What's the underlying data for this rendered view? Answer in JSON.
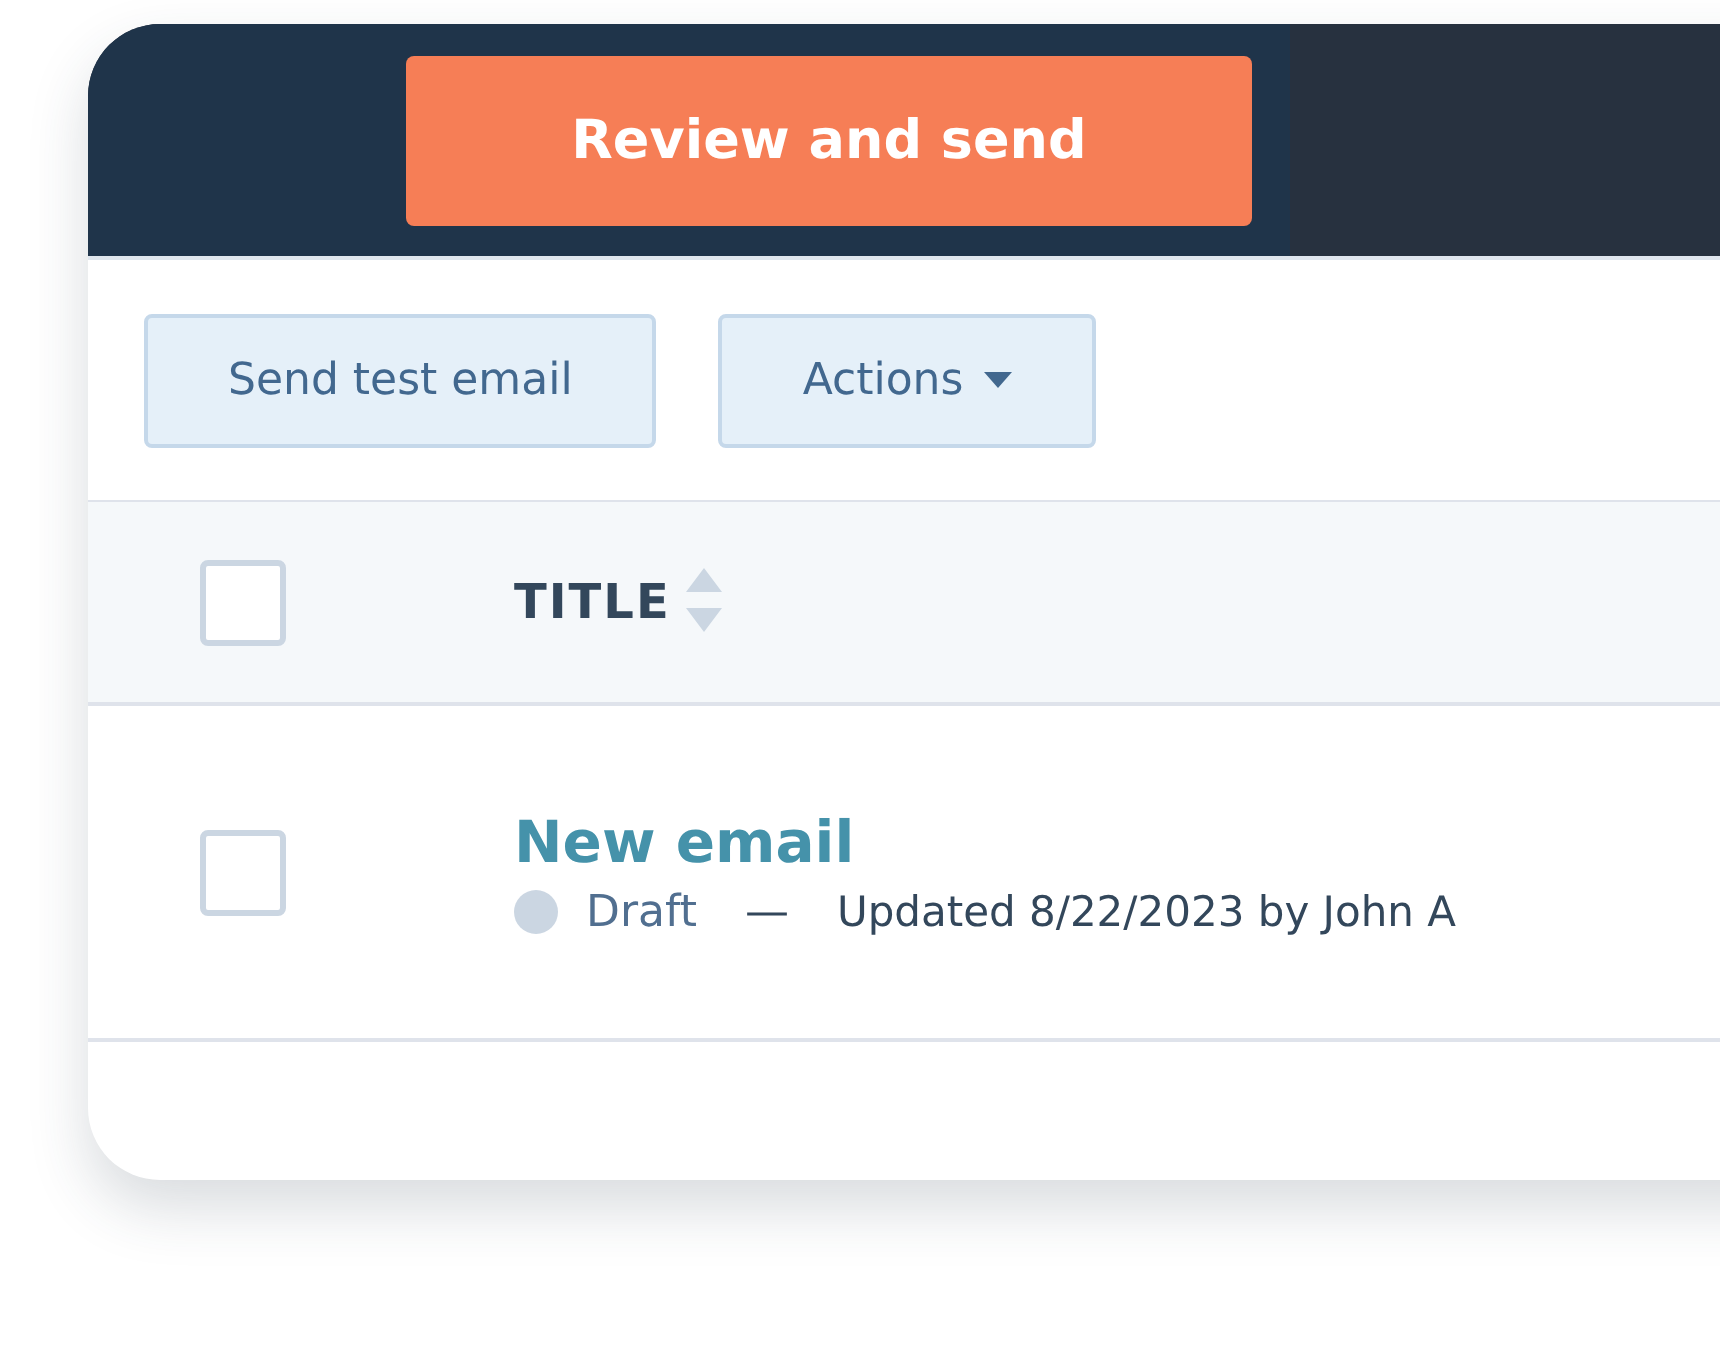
{
  "header": {
    "primary_button": "Review and send"
  },
  "toolbar": {
    "buttons": [
      {
        "label": "Send test email",
        "kind": "plain"
      },
      {
        "label": "Actions",
        "kind": "dropdown"
      }
    ]
  },
  "table": {
    "select_all": {
      "checked": false
    },
    "columns": [
      {
        "label": "TITLE",
        "sortable": true
      }
    ],
    "rows": [
      {
        "checked": false,
        "title": "New email",
        "status": "Draft",
        "color": "#cbd6e2",
        "separator": "—",
        "updated": "Updated 8/22/2023 by John A"
      }
    ]
  }
}
